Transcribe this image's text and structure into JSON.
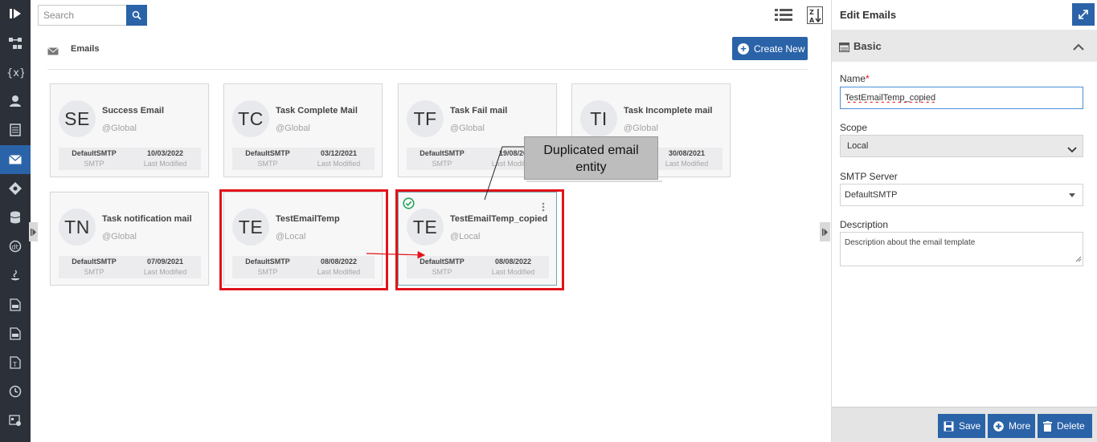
{
  "search": {
    "placeholder": "Search"
  },
  "section": {
    "title": "Emails",
    "create_label": "Create New"
  },
  "cards": [
    {
      "initials": "SE",
      "name": "Success Email",
      "scope": "@Global",
      "smtp": "DefaultSMTP",
      "smtp_label": "SMTP",
      "date": "10/03/2022",
      "date_label": "Last Modified"
    },
    {
      "initials": "TC",
      "name": "Task Complete Mail",
      "scope": "@Global",
      "smtp": "DefaultSMTP",
      "smtp_label": "SMTP",
      "date": "03/12/2021",
      "date_label": "Last Modified"
    },
    {
      "initials": "TF",
      "name": "Task Fail mail",
      "scope": "@Global",
      "smtp": "DefaultSMTP",
      "smtp_label": "SMTP",
      "date": "19/08/20",
      "date_label": "Last Modified"
    },
    {
      "initials": "TI",
      "name": "Task Incomplete mail",
      "scope": "@Global",
      "smtp": "",
      "smtp_label": "",
      "date": "30/08/2021",
      "date_label": "Last Modified"
    },
    {
      "initials": "TN",
      "name": "Task notification mail",
      "scope": "@Global",
      "smtp": "DefaultSMTP",
      "smtp_label": "SMTP",
      "date": "07/09/2021",
      "date_label": "Last Modified"
    },
    {
      "initials": "TE",
      "name": "TestEmailTemp",
      "scope": "@Local",
      "smtp": "DefaultSMTP",
      "smtp_label": "SMTP",
      "date": "08/08/2022",
      "date_label": "Last Modified"
    },
    {
      "initials": "TE",
      "name": "TestEmailTemp_copied",
      "scope": "@Local",
      "smtp": "DefaultSMTP",
      "smtp_label": "SMTP",
      "date": "08/08/2022",
      "date_label": "Last Modified"
    }
  ],
  "callout": {
    "line1": "Duplicated email",
    "line2": "entity"
  },
  "panel": {
    "title": "Edit Emails",
    "section": "Basic",
    "name_label": "Name",
    "required_mark": "*",
    "name_value": "TestEmailTemp_copied",
    "scope_label": "Scope",
    "scope_value": "Local",
    "smtp_label": "SMTP Server",
    "smtp_value": "DefaultSMTP",
    "description_label": "Description",
    "description_value": "Description about the email template",
    "save_label": "Save",
    "more_label": "More",
    "delete_label": "Delete"
  },
  "colors": {
    "accent": "#2b63a8",
    "highlight": "#e2131b",
    "rail": "#2c3038"
  }
}
